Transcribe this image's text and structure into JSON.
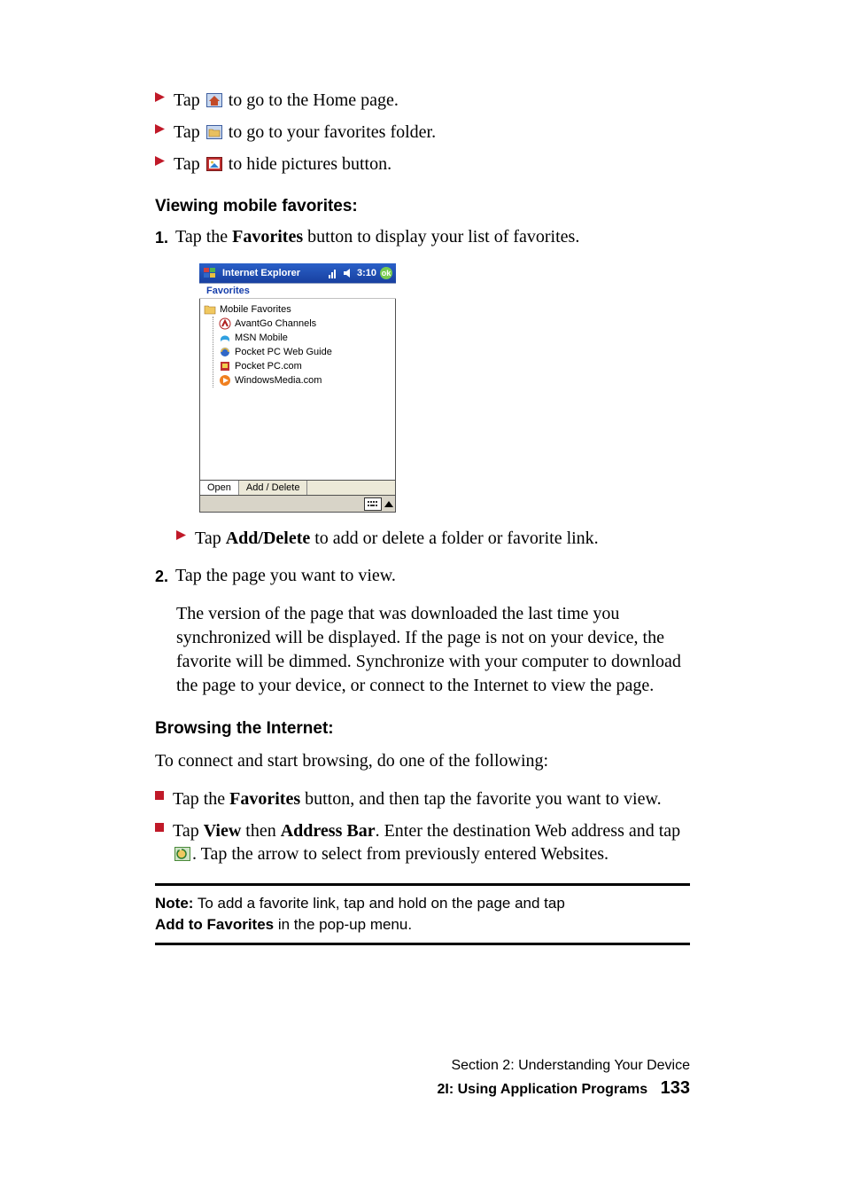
{
  "tap_bullets": [
    {
      "icon": "home-icon",
      "pre": "Tap ",
      "post": " to go to the Home page."
    },
    {
      "icon": "folder-icon",
      "pre": "Tap ",
      "post": " to go to your favorites folder."
    },
    {
      "icon": "picture-icon",
      "pre": "Tap ",
      "post": " to hide pictures button."
    }
  ],
  "heading_viewing": "Viewing mobile favorites:",
  "step1": {
    "num": "1.",
    "pre": "Tap the ",
    "bold": "Favorites",
    "post": " button to display your list of favorites."
  },
  "screenshot": {
    "title": "Internet Explorer",
    "time": "3:10",
    "ok": "ok",
    "subbar": "Favorites",
    "root": "Mobile Favorites",
    "items": [
      "AvantGo Channels",
      "MSN Mobile",
      "Pocket PC Web Guide",
      "Pocket PC.com",
      "WindowsMedia.com"
    ],
    "tab_open": "Open",
    "tab_add_delete": "Add / Delete"
  },
  "sub_bullet_add_delete": {
    "pre": "Tap ",
    "bold": "Add/Delete",
    "post": " to add or delete a folder or favorite link."
  },
  "step2": {
    "num": "2.",
    "text": "Tap the page you want to view."
  },
  "sync_para": "The version of the page that was downloaded the last time you synchronized will be displayed. If the page is not on your device, the favorite will be dimmed. Synchronize with your computer to download the page to your device, or connect to the Internet to view the page.",
  "heading_browsing": "Browsing the Internet:",
  "browsing_intro": "To connect and start browsing, do one of the following:",
  "browse_bullets": [
    {
      "parts": [
        {
          "t": "Tap the "
        },
        {
          "b": "Favorites"
        },
        {
          "t": " button, and then tap the favorite you want to view."
        }
      ]
    },
    {
      "parts": [
        {
          "t": "Tap "
        },
        {
          "b": "View"
        },
        {
          "t": " then "
        },
        {
          "b": "Address Bar"
        },
        {
          "t": ". Enter the destination Web address and tap "
        },
        {
          "icon": "go-icon"
        },
        {
          "t": ". Tap the arrow to select from previously entered Websites."
        }
      ]
    }
  ],
  "note": {
    "label": "Note:",
    "line1": " To add a favorite link, tap and hold on the page and tap ",
    "bold_line2": "Add to Favorites",
    "line2_rest": " in the pop-up menu."
  },
  "footer": {
    "section": "Section 2: Understanding Your Device",
    "chapter": "2I: Using Application Programs",
    "page": "133"
  }
}
